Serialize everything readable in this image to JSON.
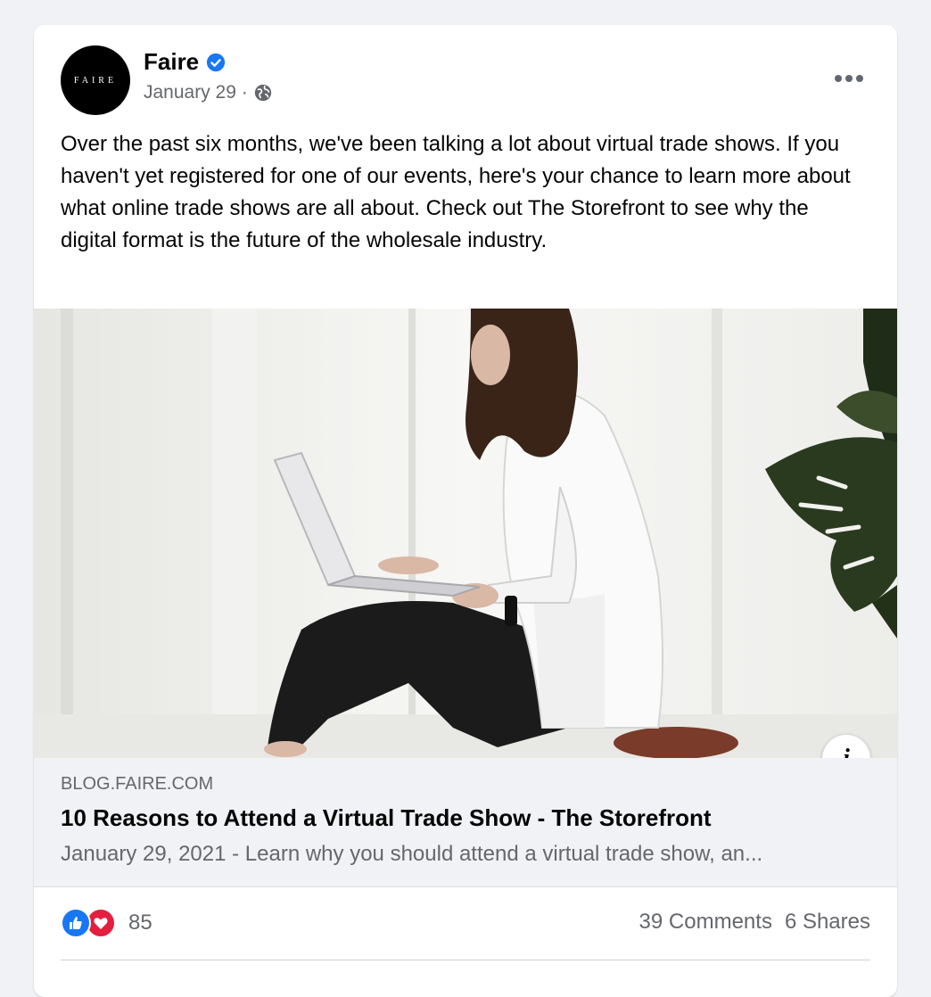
{
  "post": {
    "author": "Faire",
    "avatar_text": "FAIRE",
    "date": "January 29 ·",
    "text": "Over the past six months, we've been talking a lot about virtual trade shows. If you haven't yet registered for one of our events, here's your chance to learn more about what online trade shows are all about. Check out The Storefront to see why the digital format is the future of the wholesale industry.",
    "more_icon": "more-horizontal-icon",
    "privacy_icon": "globe-icon",
    "verified_icon": "verified-badge-icon"
  },
  "link": {
    "domain": "BLOG.FAIRE.COM",
    "title": "10 Reasons to Attend a Virtual Trade Show - The Storefront",
    "description": "January 29, 2021 - Learn why you should attend a virtual trade show, an...",
    "info_label": "i"
  },
  "stats": {
    "reaction_count": "85",
    "comments": "39 Comments",
    "shares": "6 Shares"
  },
  "colors": {
    "brand_blue": "#1877f2",
    "love_red": "#e41e3f",
    "secondary_text": "#65676b"
  }
}
